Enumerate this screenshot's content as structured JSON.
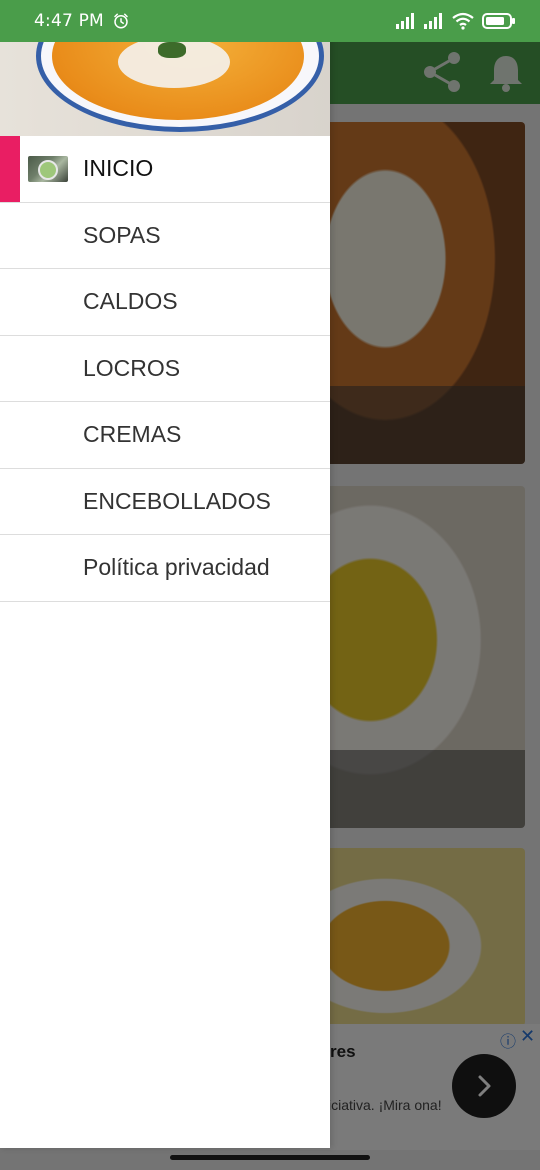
{
  "status_bar": {
    "time": "4:47 PM",
    "icons": [
      "alarm-icon",
      "signal-icon",
      "signal-icon",
      "wifi-icon",
      "battery-icon"
    ]
  },
  "colors": {
    "status_bar": "#4a9d4a",
    "app_bar": "#4a9d4a",
    "active_indicator": "#e91e63"
  },
  "app_bar": {
    "icons": [
      "share-icon",
      "bell-icon"
    ]
  },
  "drawer": {
    "items": [
      {
        "label": "INICIO",
        "active": true
      },
      {
        "label": "SOPAS"
      },
      {
        "label": "CALDOS"
      },
      {
        "label": "LOCROS"
      },
      {
        "label": "CREMAS"
      },
      {
        "label": "ENCEBOLLADOS"
      },
      {
        "label": "Política privacidad"
      }
    ]
  },
  "ad": {
    "title": "res",
    "text": "iciativa. ¡Mira ona!",
    "info_glyph": "ⓘ",
    "close_glyph": "✕"
  }
}
